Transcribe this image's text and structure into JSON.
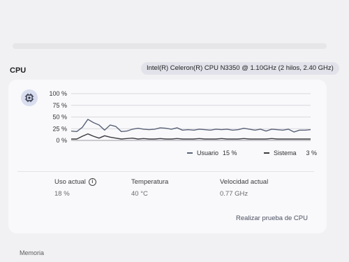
{
  "section": {
    "title": "CPU"
  },
  "cpu": {
    "model": "Intel(R) Celeron(R) CPU N3350 @ 1.10GHz (2 hilos, 2.40 GHz)"
  },
  "chart_data": {
    "type": "line",
    "y_ticks": [
      "100 %",
      "75 %",
      "50 %",
      "25 %",
      "0 %"
    ],
    "ylim": [
      0,
      100
    ],
    "grid": true,
    "legend_position": "bottom-right",
    "series": [
      {
        "name": "Usuario",
        "color": "#5a6378",
        "values": [
          20,
          19,
          28,
          45,
          38,
          33,
          22,
          33,
          30,
          19,
          20,
          24,
          26,
          24,
          23,
          24,
          27,
          26,
          24,
          27,
          22,
          23,
          22,
          24,
          23,
          22,
          24,
          23,
          24,
          22,
          23,
          26,
          24,
          22,
          24,
          20,
          24,
          23,
          22,
          24,
          18,
          22,
          22,
          23
        ]
      },
      {
        "name": "Sistema",
        "color": "#3a3a40",
        "values": [
          3,
          3,
          9,
          14,
          9,
          5,
          10,
          7,
          5,
          3,
          4,
          5,
          3,
          4,
          3,
          3,
          4,
          3,
          3,
          4,
          3,
          3,
          3,
          4,
          3,
          3,
          3,
          4,
          3,
          3,
          3,
          4,
          3,
          3,
          3,
          3,
          4,
          3,
          3,
          3,
          3,
          3,
          3,
          3
        ]
      }
    ]
  },
  "legend": {
    "user_label": "Usuario",
    "user_value": "15 %",
    "system_label": "Sistema",
    "system_value": "3 %"
  },
  "stats": {
    "usage_label": "Uso actual",
    "usage_value": "18 %",
    "temp_label": "Temperatura",
    "temp_value": "40 °C",
    "speed_label": "Velocidad actual",
    "speed_value": "0.77 GHz"
  },
  "actions": {
    "cpu_test": "Realizar prueba de CPU"
  },
  "footer": {
    "memory_label": "Memoria"
  },
  "icons": {
    "cpu": "cpu-chip-icon",
    "info": "info-icon"
  },
  "colors": {
    "accent": "#d8deef",
    "card": "#f9f9fb",
    "user_line": "#5a6378",
    "system_line": "#3a3a40"
  }
}
